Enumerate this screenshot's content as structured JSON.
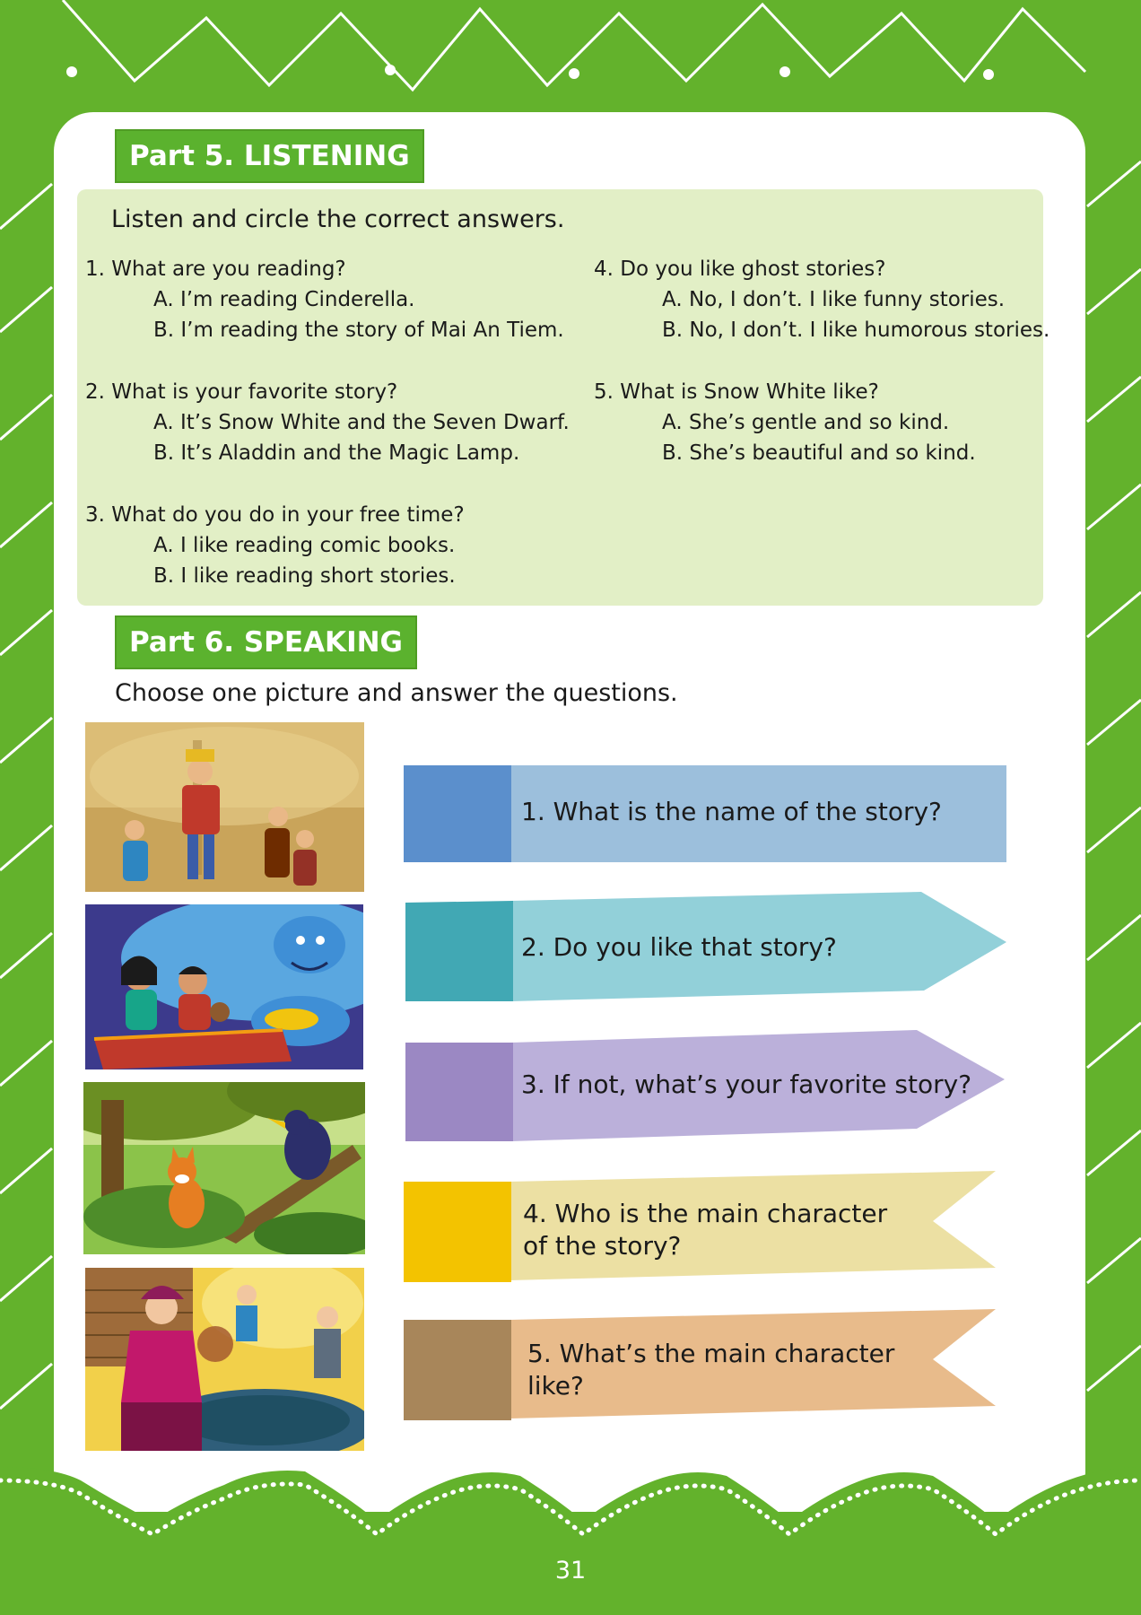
{
  "part5": {
    "heading": "Part 5. LISTENING",
    "instruction": "Listen and circle the correct answers.",
    "questions": [
      {
        "q": "1. What are you reading?",
        "a": "A. I’m reading Cinderella.",
        "b": "B. I’m reading the story of Mai An Tiem."
      },
      {
        "q": "2. What is your favorite story?",
        "a": "A. It’s Snow White and the Seven Dwarf.",
        "b": "B. It’s Aladdin and the Magic Lamp."
      },
      {
        "q": "3. What do you do in your free time?",
        "a": "A. I like reading comic books.",
        "b": "B. I like reading short stories."
      },
      {
        "q": "4. Do you like ghost stories?",
        "a": "A. No, I don’t. I like funny stories.",
        "b": "B. No, I don’t. I like humorous stories."
      },
      {
        "q": "5. What is Snow White like?",
        "a": "A. She’s gentle and so kind.",
        "b": "B. She’s beautiful and so kind."
      }
    ]
  },
  "part6": {
    "heading": "Part 6. SPEAKING",
    "instruction": "Choose one picture and answer the questions.",
    "prompts": [
      {
        "line1": "1. What is the name of the story?",
        "line2": "",
        "tab_color": "#5b8fcc",
        "body_color": "#9cbfdc"
      },
      {
        "line1": "2. Do you like that story?",
        "line2": "",
        "tab_color": "#41a8b4",
        "body_color": "#92d0d9"
      },
      {
        "line1": "3. If not, what’s your favorite story?",
        "line2": "",
        "tab_color": "#9b88c3",
        "body_color": "#bbb0da"
      },
      {
        "line1": "4. Who is the main character",
        "line2": "of the story?",
        "tab_color": "#f3c300",
        "body_color": "#ece0a3"
      },
      {
        "line1": "5. What’s the main character",
        "line2": "like?",
        "tab_color": "#a8865a",
        "body_color": "#e8bb8b"
      }
    ]
  },
  "page_number": "31"
}
